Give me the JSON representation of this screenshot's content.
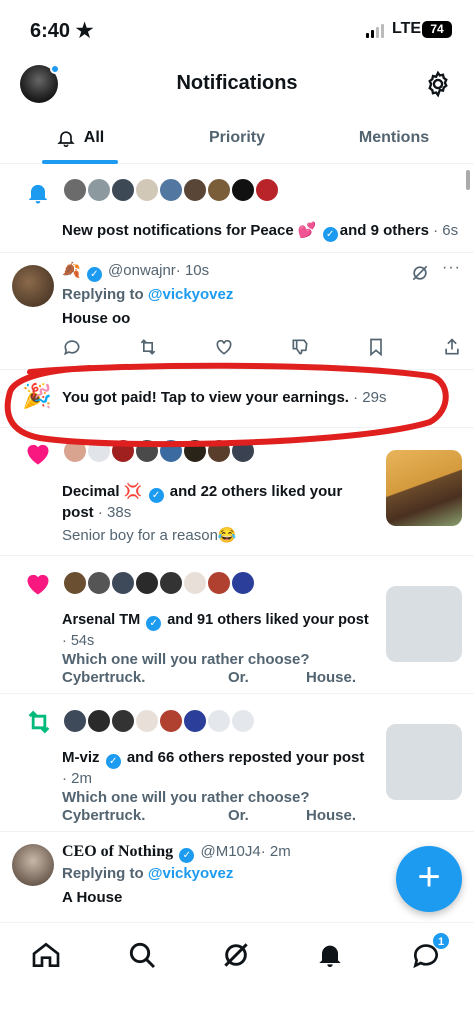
{
  "status": {
    "time": "6:40 ★",
    "network": "LTE",
    "battery": "74"
  },
  "header": {
    "title": "Notifications"
  },
  "tabs": [
    {
      "label": "All"
    },
    {
      "label": "Priority"
    },
    {
      "label": "Mentions"
    }
  ],
  "notifications": [
    {
      "type": "new-posts",
      "text_main": "New post notifications for Peace 💕",
      "text_suffix": "and 9 others",
      "time": "· 6s"
    },
    {
      "type": "reply",
      "name_emoji": "🍂",
      "handle": "@onwajnr",
      "time": "· 10s",
      "replying_to_prefix": "Replying to",
      "replying_to": "@vickyovez",
      "body": "House oo"
    },
    {
      "type": "earnings",
      "text": "You got paid! Tap to view your earnings.",
      "time": "· 29s"
    },
    {
      "type": "like",
      "name": "Decimal 💢",
      "text": "and 22 others liked your post",
      "time": "· 38s",
      "snippet": "Senior boy for a reason😂"
    },
    {
      "type": "like",
      "name": "Arsenal TM",
      "text": "and 91 others liked your post",
      "time": "· 54s",
      "snippet_line1": "Which one will you rather choose?",
      "snippet_line2": [
        "Cybertruck.",
        "Or.",
        "House."
      ]
    },
    {
      "type": "repost",
      "name": "M-viz",
      "text": "and 66 others reposted your post",
      "time": "· 2m",
      "snippet_line1": "Which one will you rather choose?",
      "snippet_line2": [
        "Cybertruck.",
        "Or.",
        "House."
      ]
    },
    {
      "type": "reply",
      "name": "CEO of Nothing",
      "handle": "@M10J4",
      "time": "· 2m",
      "replying_to_prefix": "Replying to",
      "replying_to": "@vickyovez",
      "body": "A House"
    }
  ],
  "fab": {
    "label": "+"
  },
  "bottom_nav": {
    "messages_badge": "1"
  },
  "colors": {
    "accent": "#1d9bf0",
    "like": "#f91880",
    "repost": "#00ba7c",
    "highlight_circle": "#e0201f"
  }
}
